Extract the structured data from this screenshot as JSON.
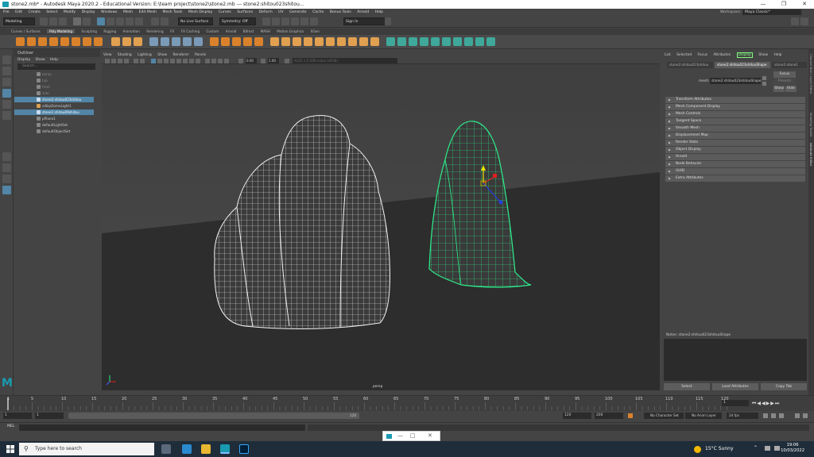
{
  "window": {
    "title": "stone2.mb* - Autodesk Maya 2020.2 - Educational Version: E:\\team project\\stone2\\stone2.mb  ---  stone2:shitou023shitou...",
    "workspace_label": "Workspace :",
    "workspace_value": "Maya Classic*"
  },
  "menubar": [
    "File",
    "Edit",
    "Create",
    "Select",
    "Modify",
    "Display",
    "Windows",
    "Mesh",
    "Edit Mesh",
    "Mesh Tools",
    "Mesh Display",
    "Curves",
    "Surfaces",
    "Deform",
    "UV",
    "Generate",
    "Cache",
    "Bonus Tools",
    "Arnold",
    "Help"
  ],
  "statusline": {
    "mode": "Modeling",
    "live_surface": "No Live Surface",
    "symmetry": "Symmetry: Off",
    "sign_in": "Sign In"
  },
  "shelf_tabs": [
    "Curves / Surfaces",
    "Poly Modeling",
    "Sculpting",
    "Rigging",
    "Animation",
    "Rendering",
    "FX",
    "FX Caching",
    "Custom",
    "Arnold",
    "Bifrost",
    "MASH",
    "Motion Graphics",
    "XGen"
  ],
  "shelf_active_tab": "Poly Modeling",
  "outliner": {
    "title": "Outliner",
    "menu": [
      "Display",
      "Show",
      "Help"
    ],
    "search_placeholder": "Search...",
    "items": [
      {
        "label": "persp",
        "state": "dim"
      },
      {
        "label": "top",
        "state": "dim"
      },
      {
        "label": "front",
        "state": "dim"
      },
      {
        "label": "side",
        "state": "dim"
      },
      {
        "label": "stone2:shitou023shitou",
        "state": "sel"
      },
      {
        "label": "aiSkyDomeLight1",
        "state": "normal"
      },
      {
        "label": "stone1:shitou09shitou",
        "state": "sel"
      },
      {
        "label": "pPlane1",
        "state": "normal"
      },
      {
        "label": "defaultLightSet",
        "state": "normal"
      },
      {
        "label": "defaultObjectSet",
        "state": "normal"
      }
    ]
  },
  "viewport": {
    "menu": [
      "View",
      "Shading",
      "Lighting",
      "Show",
      "Renderer",
      "Panels"
    ],
    "near_value": "0.00",
    "far_value": "1.00",
    "colorspace": "ACES 1.0 SDR-video (sRGB)",
    "camera_label": "persp"
  },
  "attribute_editor": {
    "menu": [
      "List",
      "Selected",
      "Focus",
      "Attributes",
      "Display",
      "Show",
      "Help"
    ],
    "menu_highlight": "Display",
    "tabs": [
      "stone2:shitou023shitou",
      "stone2:shitou023shitouShape",
      "stone2:stone1"
    ],
    "active_tab": "stone2:shitou023shitouShape",
    "mesh_label": "mesh:",
    "mesh_value": "stone2:shitou023shitouShape",
    "focus_button": "Focus",
    "presets_button": "Presets",
    "show_button": "Show",
    "hide_button": "Hide",
    "sections": [
      "Transform Attributes",
      "Mesh Component Display",
      "Mesh Controls",
      "Tangent Space",
      "Smooth Mesh",
      "Displacement Map",
      "Render Stats",
      "Object Display",
      "Arnold",
      "Node Behavior",
      "UUID",
      "Extra Attributes"
    ],
    "notes_label": "Notes:  stone2:shitou023shitouShape",
    "buttons": [
      "Select",
      "Load Attributes",
      "Copy Tab"
    ]
  },
  "right_strip": [
    "Channel Box / Layer Editor",
    "Modeling Toolkit",
    "Attribute Editor"
  ],
  "timeline": {
    "ticks": [
      "1",
      "5",
      "10",
      "15",
      "20",
      "25",
      "30",
      "35",
      "40",
      "45",
      "50",
      "55",
      "60",
      "65",
      "70",
      "75",
      "80",
      "85",
      "90",
      "95",
      "100",
      "105",
      "110",
      "115",
      "120"
    ],
    "current_frame": "1"
  },
  "range": {
    "start": "1",
    "start_playback": "1",
    "range_end_inner": "120",
    "end_playback": "120",
    "end": "200",
    "character_set": "No Character Set",
    "anim_layer": "No Anim Layer",
    "fps": "24 fps"
  },
  "command_line": {
    "label": "MEL"
  },
  "taskbar": {
    "search_placeholder": "Type here to search",
    "weather": "15°C  Sunny",
    "time": "19:06",
    "date": "10/03/2022"
  },
  "colors": {
    "selection": "#5285a6",
    "wire_white": "#ffffff",
    "wire_selected": "#2cf08c",
    "maya_teal": "#1a9ab0"
  }
}
